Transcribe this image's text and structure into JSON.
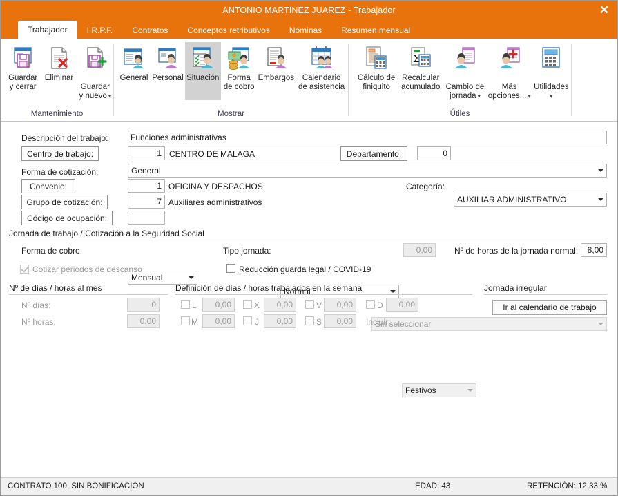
{
  "window": {
    "title": "ANTONIO MARTINEZ JUAREZ - Trabajador",
    "close_label": "✕",
    "accent_color": "#E8720C"
  },
  "tabs": [
    {
      "label": "Trabajador",
      "active": true
    },
    {
      "label": "I.R.P.F.",
      "active": false
    },
    {
      "label": "Contratos",
      "active": false
    },
    {
      "label": "Conceptos retributivos",
      "active": false
    },
    {
      "label": "Nóminas",
      "active": false
    },
    {
      "label": "Resumen mensual",
      "active": false
    }
  ],
  "ribbon": {
    "groups": [
      {
        "title": "Mantenimiento",
        "buttons": [
          {
            "label": "Guardar\ny cerrar",
            "icon": "save-close-icon",
            "dropdown": false,
            "selected": false
          },
          {
            "label": "Eliminar",
            "icon": "delete-icon",
            "dropdown": false,
            "selected": false
          },
          {
            "label": "Guardar\ny nuevo",
            "icon": "save-new-icon",
            "dropdown": true,
            "selected": false
          }
        ]
      },
      {
        "title": "Mostrar",
        "buttons": [
          {
            "label": "General",
            "icon": "general-icon",
            "dropdown": false,
            "selected": false
          },
          {
            "label": "Personal",
            "icon": "personal-icon",
            "dropdown": false,
            "selected": false
          },
          {
            "label": "Situación",
            "icon": "situacion-icon",
            "dropdown": false,
            "selected": true
          },
          {
            "label": "Forma\nde cobro",
            "icon": "forma-cobro-icon",
            "dropdown": false,
            "selected": false
          },
          {
            "label": "Embargos",
            "icon": "embargos-icon",
            "dropdown": false,
            "selected": false
          },
          {
            "label": "Calendario\nde asistencia",
            "icon": "calendario-asistencia-icon",
            "dropdown": false,
            "selected": false
          }
        ]
      },
      {
        "title": "Útiles",
        "buttons": [
          {
            "label": "Cálculo de\nfiniquito",
            "icon": "calculo-finiquito-icon",
            "dropdown": false,
            "selected": false
          },
          {
            "label": "Recalcular\nacumulado",
            "icon": "recalcular-acumulado-icon",
            "dropdown": false,
            "selected": false
          },
          {
            "label": "Cambio de\njornada",
            "icon": "cambio-jornada-icon",
            "dropdown": true,
            "selected": false
          },
          {
            "label": "Más\nopciones...",
            "icon": "mas-opciones-icon",
            "dropdown": true,
            "selected": false
          },
          {
            "label": "Utilidades",
            "icon": "utilidades-icon",
            "dropdown": true,
            "selected": false
          }
        ]
      }
    ]
  },
  "form": {
    "descripcion_label": "Descripción del trabajo:",
    "descripcion_value": "Funciones administrativas",
    "centro_trabajo_label": "Centro de trabajo:",
    "centro_trabajo_code": "1",
    "centro_trabajo_name": "CENTRO DE MALAGA",
    "departamento_label": "Departamento:",
    "departamento_value": "0",
    "forma_cotizacion_label": "Forma de cotización:",
    "forma_cotizacion_value": "General",
    "convenio_label": "Convenio:",
    "convenio_code": "1",
    "convenio_name": "OFICINA Y DESPACHOS",
    "categoria_label": "Categoría:",
    "categoria_value": "AUXILIAR ADMINISTRATIVO",
    "grupo_cotizacion_label": "Grupo de cotización:",
    "grupo_cotizacion_code": "7",
    "grupo_cotizacion_name": "Auxiliares administrativos",
    "codigo_ocupacion_label": "Código de ocupación:",
    "codigo_ocupacion_value": "",
    "jornada_section_title": "Jornada de trabajo / Cotización a la Seguridad Social",
    "forma_cobro_label": "Forma de cobro:",
    "forma_cobro_value": "Mensual",
    "tipo_jornada_label": "Tipo jornada:",
    "tipo_jornada_value": "Normal",
    "tipo_jornada_num": "0,00",
    "horas_jornada_label": "Nº de horas de la jornada normal:",
    "horas_jornada_value": "8,00",
    "cotizar_descanso_label": "Cotizar periodos de descanso",
    "cotizar_descanso_checked": true,
    "reduccion_label": "Reducción guarda legal / COVID-19",
    "reduccion_checked": false,
    "reduccion_combo_value": "Sin seleccionar",
    "dias_mes_title": "Nº de días / horas al mes",
    "n_dias_label": "Nº días:",
    "n_dias_value": "0",
    "n_horas_label": "Nº horas:",
    "n_horas_value": "0,00",
    "semana_title": "Definición de días / horas trabajados en la semana",
    "dias_semana": [
      {
        "key": "L",
        "value": "0,00",
        "checked": false
      },
      {
        "key": "M",
        "value": "0,00",
        "checked": false
      },
      {
        "key": "X",
        "value": "0,00",
        "checked": false
      },
      {
        "key": "J",
        "value": "0,00",
        "checked": false
      },
      {
        "key": "V",
        "value": "0,00",
        "checked": false
      },
      {
        "key": "S",
        "value": "0,00",
        "checked": false
      },
      {
        "key": "D",
        "value": "0,00",
        "checked": false
      }
    ],
    "incluir_label": "Incluir:",
    "incluir_value": "Festivos",
    "jornada_irregular_title": "Jornada irregular",
    "ir_calendario_label": "Ir al calendario de trabajo"
  },
  "statusbar": {
    "contrato": "CONTRATO 100.  SIN BONIFICACIÓN",
    "edad": "EDAD: 43",
    "retencion": "RETENCIÓN: 12,33 %"
  }
}
